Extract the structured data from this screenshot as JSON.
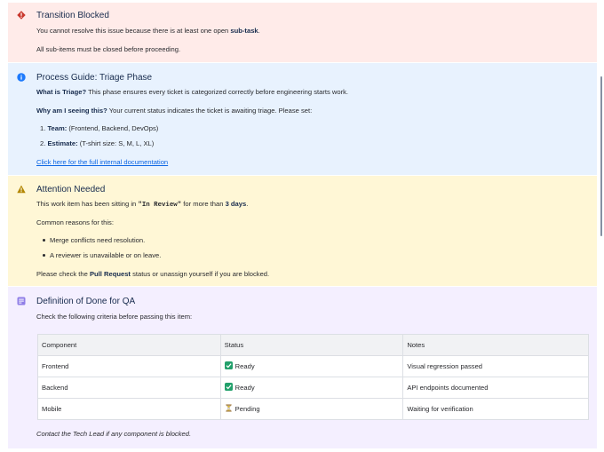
{
  "colors": {
    "error_bg": "#ffebe9",
    "info_bg": "#e8f2fe",
    "warning_bg": "#fff7d6",
    "note_bg": "#f4efff",
    "error_icon": "#c9372c",
    "info_icon": "#1d7afc",
    "warning_icon": "#b38600",
    "note_icon": "#8f7ee7",
    "link": "#0c66e4",
    "ready_check": "#22a06b"
  },
  "error_panel": {
    "icon": "diamond-error-icon",
    "title": "Transition Blocked",
    "line1_pre": "You cannot resolve this issue because there is at least one open ",
    "line1_bold": "sub-task",
    "line1_post": ".",
    "line2": "All sub-items must be closed before proceeding."
  },
  "info_panel": {
    "icon": "info-icon",
    "title": "Process Guide: Triage Phase",
    "q1_bold": "What is Triage?",
    "q1_text": " This phase ensures every ticket is categorized correctly before engineering starts work.",
    "q2_bold": "Why am I seeing this?",
    "q2_text": " Your current status indicates the ticket is awaiting triage. Please set:",
    "item1_num": "1.",
    "item1_bold": "Team:",
    "item1_text": " (Frontend, Backend, DevOps)",
    "item2_num": "2.",
    "item2_bold": "Estimate:",
    "item2_text": " (T-shirt size: S, M, L, XL)",
    "link": "Click here for the full internal documentation"
  },
  "warning_panel": {
    "icon": "warning-triangle-icon",
    "title": "Attention Needed",
    "line1_pre": "This work item has been sitting in ",
    "line1_code": "\"In Review\"",
    "line1_mid": " for more than ",
    "line1_bold": "3 days",
    "line1_post": ".",
    "line2": "Common reasons for this:",
    "bullet1": "Merge conflicts need resolution.",
    "bullet2": "A reviewer is unavailable or on leave.",
    "line3_pre": "Please check the ",
    "line3_bold": "Pull Request",
    "line3_post": " status or unassign yourself if you are blocked."
  },
  "note_panel": {
    "icon": "note-icon",
    "title": "Definition of Done for QA",
    "intro": "Check the following criteria before passing this item:",
    "table": {
      "headers": [
        "Component",
        "Status",
        "Notes"
      ],
      "rows": [
        {
          "component": "Frontend",
          "status_icon": "check-mark-icon",
          "status": "Ready",
          "notes": "Visual regression passed"
        },
        {
          "component": "Backend",
          "status_icon": "check-mark-icon",
          "status": "Ready",
          "notes": "API endpoints documented"
        },
        {
          "component": "Mobile",
          "status_icon": "hourglass-icon",
          "status": "Pending",
          "notes": "Waiting for verification"
        }
      ]
    },
    "footer": "Contact the Tech Lead if any component is blocked."
  }
}
